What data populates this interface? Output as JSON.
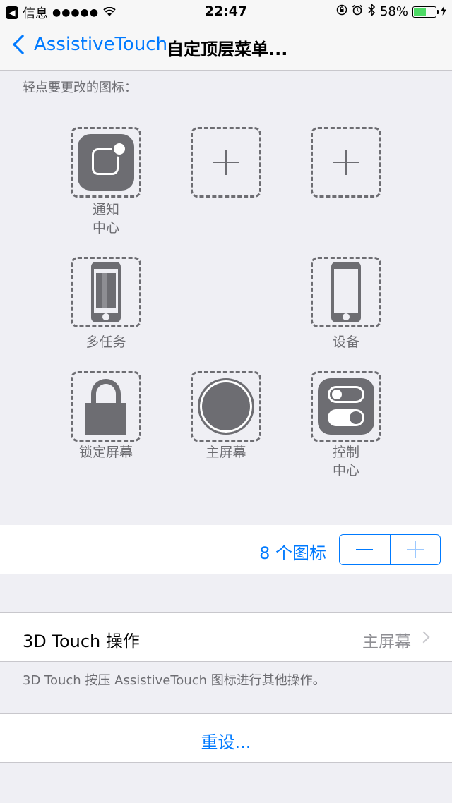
{
  "status_bar": {
    "back_app": "信息",
    "signal": "●●●●●",
    "wifi": "wifi",
    "time": "22:47",
    "icons": [
      "orientation-lock-icon",
      "alarm-icon",
      "bluetooth-icon"
    ],
    "battery_percent": "58%",
    "battery_level": 0.58,
    "battery_color": "#4cd964"
  },
  "nav": {
    "back_label": "AssistiveTouch",
    "title": "自定顶层菜单..."
  },
  "section_header": "轻点要更改的图标：",
  "slots": [
    {
      "icon": "notification-center-icon",
      "label_line1": "通知",
      "label_line2": "中心"
    },
    {
      "icon": "plus-icon",
      "label_line1": "",
      "label_line2": ""
    },
    {
      "icon": "plus-icon",
      "label_line1": "",
      "label_line2": ""
    },
    {
      "icon": "multitasking-icon",
      "label_line1": "多任务",
      "label_line2": ""
    },
    {
      "icon": "device-icon",
      "label_line1": "设备",
      "label_line2": ""
    },
    {
      "icon": "lock-screen-icon",
      "label_line1": "锁定屏幕",
      "label_line2": ""
    },
    {
      "icon": "home-icon",
      "label_line1": "主屏幕",
      "label_line2": ""
    },
    {
      "icon": "control-center-icon",
      "label_line1": "控制",
      "label_line2": "中心"
    }
  ],
  "icon_count": {
    "label": "8 个图标"
  },
  "touch_3d": {
    "label": "3D Touch 操作",
    "value": "主屏幕",
    "footer": "3D Touch 按压 AssistiveTouch 图标进行其他操作。"
  },
  "reset": {
    "label": "重设..."
  },
  "colors": {
    "accent": "#007aff",
    "icon_gray": "#6d6d72",
    "background": "#efeff4"
  }
}
